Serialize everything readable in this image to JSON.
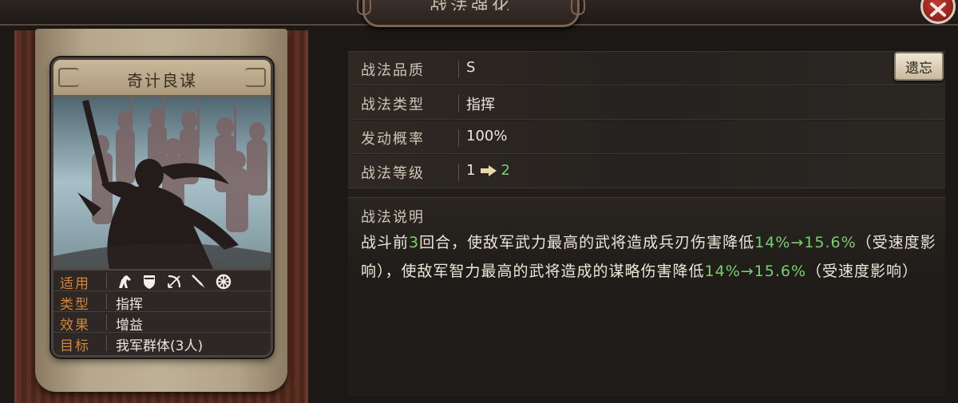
{
  "window": {
    "title": "战法强化",
    "close_icon": "close-icon"
  },
  "card": {
    "name": "奇计良谋",
    "info": [
      {
        "key": "适用",
        "icons": [
          "cavalry-icon",
          "shield-icon",
          "bow-icon",
          "spear-icon",
          "wheel-icon"
        ]
      },
      {
        "key": "类型",
        "value": "指挥"
      },
      {
        "key": "效果",
        "value": "增益"
      },
      {
        "key": "目标",
        "value": "我军群体(3人)"
      }
    ]
  },
  "details": {
    "quality": {
      "label": "战法品质",
      "value": "S"
    },
    "type": {
      "label": "战法类型",
      "value": "指挥"
    },
    "rate": {
      "label": "发动概率",
      "value": "100%"
    },
    "level": {
      "label": "战法等级",
      "current": "1",
      "next": "2"
    },
    "forget_button": "遗忘",
    "description": {
      "title": "战法说明",
      "seg1": "战斗前",
      "seg2": "3",
      "seg3": "回合，使敌军武力最高的武将造成兵刃伤害降低",
      "seg4": "14%→15.6%",
      "seg5": "（受速度影响），使敌军智力最高的武将造成的谋略伤害降低",
      "seg6": "14%→15.6%",
      "seg7": "（受速度影响）"
    }
  },
  "colors": {
    "highlight_green": "#79d06e",
    "label_orange": "#d2863a"
  }
}
